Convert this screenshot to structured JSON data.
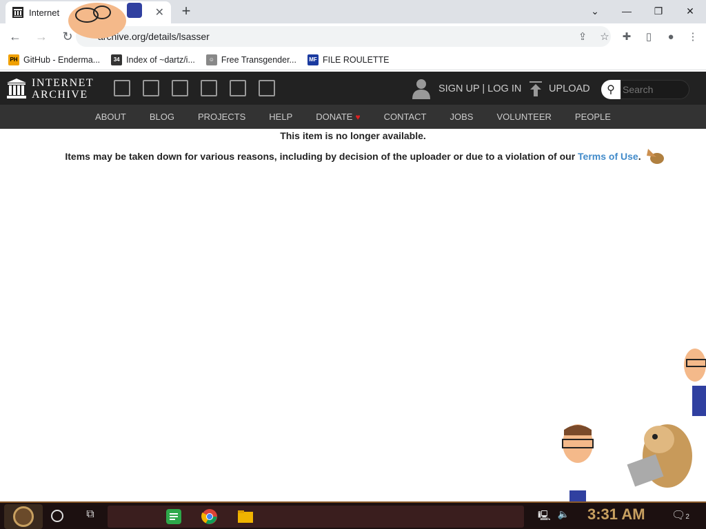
{
  "browser": {
    "tab_title": "Internet",
    "url": "archive.org/details/lsasser",
    "bookmarks": [
      {
        "label": "GitHub - Enderma...",
        "icon": "ph-icon",
        "color": "#f0a000"
      },
      {
        "label": "Index of ~dartz/i...",
        "icon": "dartz-icon",
        "color": "#333333"
      },
      {
        "label": "Free Transgender...",
        "icon": "robot-icon",
        "color": "#555555"
      },
      {
        "label": "FILE ROULETTE",
        "icon": "mf-icon",
        "color": "#1a3aa0"
      }
    ]
  },
  "ia": {
    "logo_line1": "INTERNET",
    "logo_line2": "ARCHIVE",
    "account": "SIGN UP | LOG IN",
    "upload": "UPLOAD",
    "search_placeholder": "Search",
    "subnav": [
      "ABOUT",
      "BLOG",
      "PROJECTS",
      "HELP",
      "DONATE",
      "CONTACT",
      "JOBS",
      "VOLUNTEER",
      "PEOPLE"
    ]
  },
  "notice": {
    "title": "This item is no longer available.",
    "body": "Items may be taken down for various reasons, including by decision of the uploader or due to a violation of our ",
    "link": "Terms of Use",
    "end": "."
  },
  "taskbar": {
    "time": "3:31 AM",
    "notification_count": "2"
  }
}
